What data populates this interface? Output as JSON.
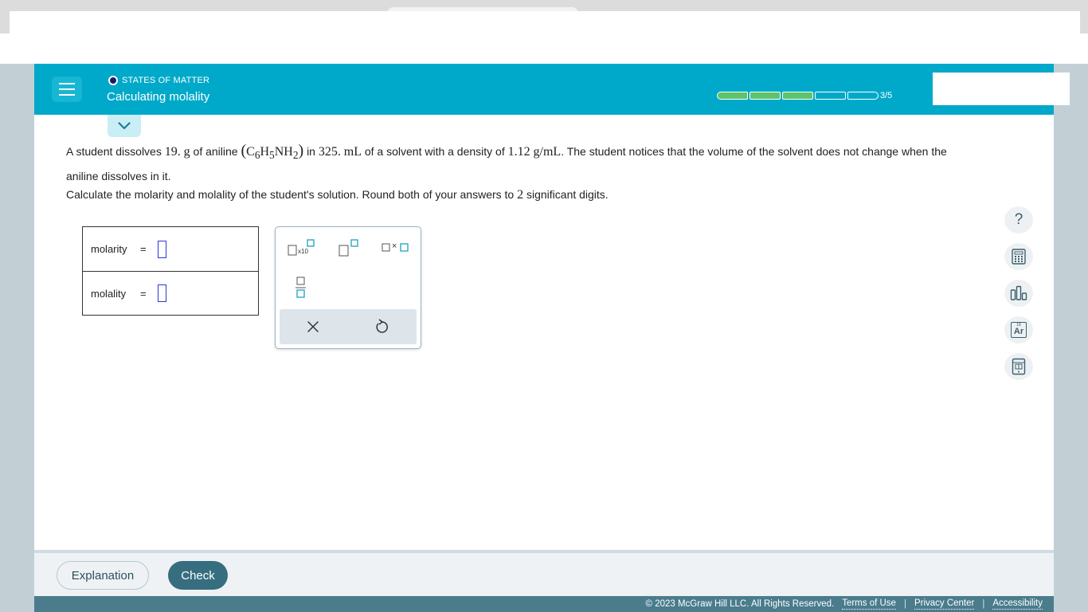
{
  "header": {
    "topic": "STATES OF MATTER",
    "title": "Calculating molality",
    "progress": {
      "completed": 3,
      "total": 5,
      "text": "3/5"
    },
    "colors": {
      "header_bg": "#00a9c9",
      "progress_done": "#5ec36b"
    }
  },
  "question": {
    "part1": "A student dissolves",
    "mass": "19.",
    "mass_unit": "g",
    "part2": "of aniline",
    "formula": {
      "c": "C",
      "c_sub": "6",
      "h": "H",
      "h_sub": "5",
      "n": "NH",
      "n_sub": "2"
    },
    "part3": "in",
    "volume": "325.",
    "volume_unit": "mL",
    "part4": "of a solvent with a density of",
    "density": "1.12",
    "density_unit": "g/mL",
    "part5": ". The student notices that the volume of the solvent does not change when the aniline dissolves in it."
  },
  "instruction": {
    "before": "Calculate the molarity and molality of the student's solution. Round both of your answers to",
    "digits": "2",
    "after": "significant digits."
  },
  "answers": [
    {
      "label": "molarity",
      "eq": "=",
      "value": ""
    },
    {
      "label": "molality",
      "eq": "=",
      "value": ""
    }
  ],
  "keypad": {
    "sci_label": "x10",
    "times": "×",
    "buttons": [
      "scientific-notation",
      "superscript",
      "multiply",
      "fraction",
      "clear",
      "undo"
    ]
  },
  "side_tools": {
    "help": "?",
    "periodic_symbol": "Ar",
    "periodic_number": "18",
    "icons": [
      "help-icon",
      "calculator-icon",
      "chart-icon",
      "periodic-table-icon",
      "data-icon"
    ]
  },
  "footer": {
    "explanation_label": "Explanation",
    "check_label": "Check",
    "copyright": "© 2023 McGraw Hill LLC. All Rights Reserved.",
    "terms": "Terms of Use",
    "privacy": "Privacy Center",
    "accessibility": "Accessibility",
    "sep": "|"
  }
}
